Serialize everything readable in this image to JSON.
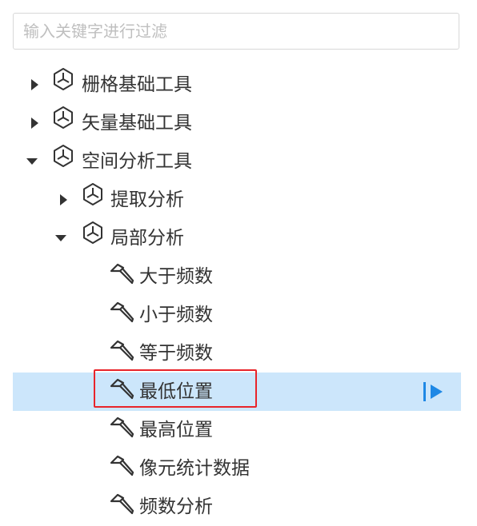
{
  "search": {
    "placeholder": "输入关键字进行过滤",
    "value": ""
  },
  "tree": {
    "raster_tools": "栅格基础工具",
    "vector_tools": "矢量基础工具",
    "spatial_analysis": "空间分析工具",
    "extract_analysis": "提取分析",
    "local_analysis": "局部分析",
    "tools": {
      "greater_than_frequency": "大于频数",
      "less_than_frequency": "小于频数",
      "equal_to_frequency": "等于频数",
      "lowest_position": "最低位置",
      "highest_position": "最高位置",
      "cell_statistics": "像元统计数据",
      "frequency_analysis": "频数分析"
    }
  },
  "colors": {
    "selected_row_bg": "#cce6fb",
    "highlight_border": "#e8242a",
    "run_button": "#1e88e5",
    "icon_stroke": "#333333"
  },
  "icons": {
    "collapsed": "caret-right-icon",
    "expanded": "caret-down-icon",
    "toolbox": "toolbox-hexagon-icon",
    "tool": "hammer-icon",
    "run": "run-icon"
  }
}
